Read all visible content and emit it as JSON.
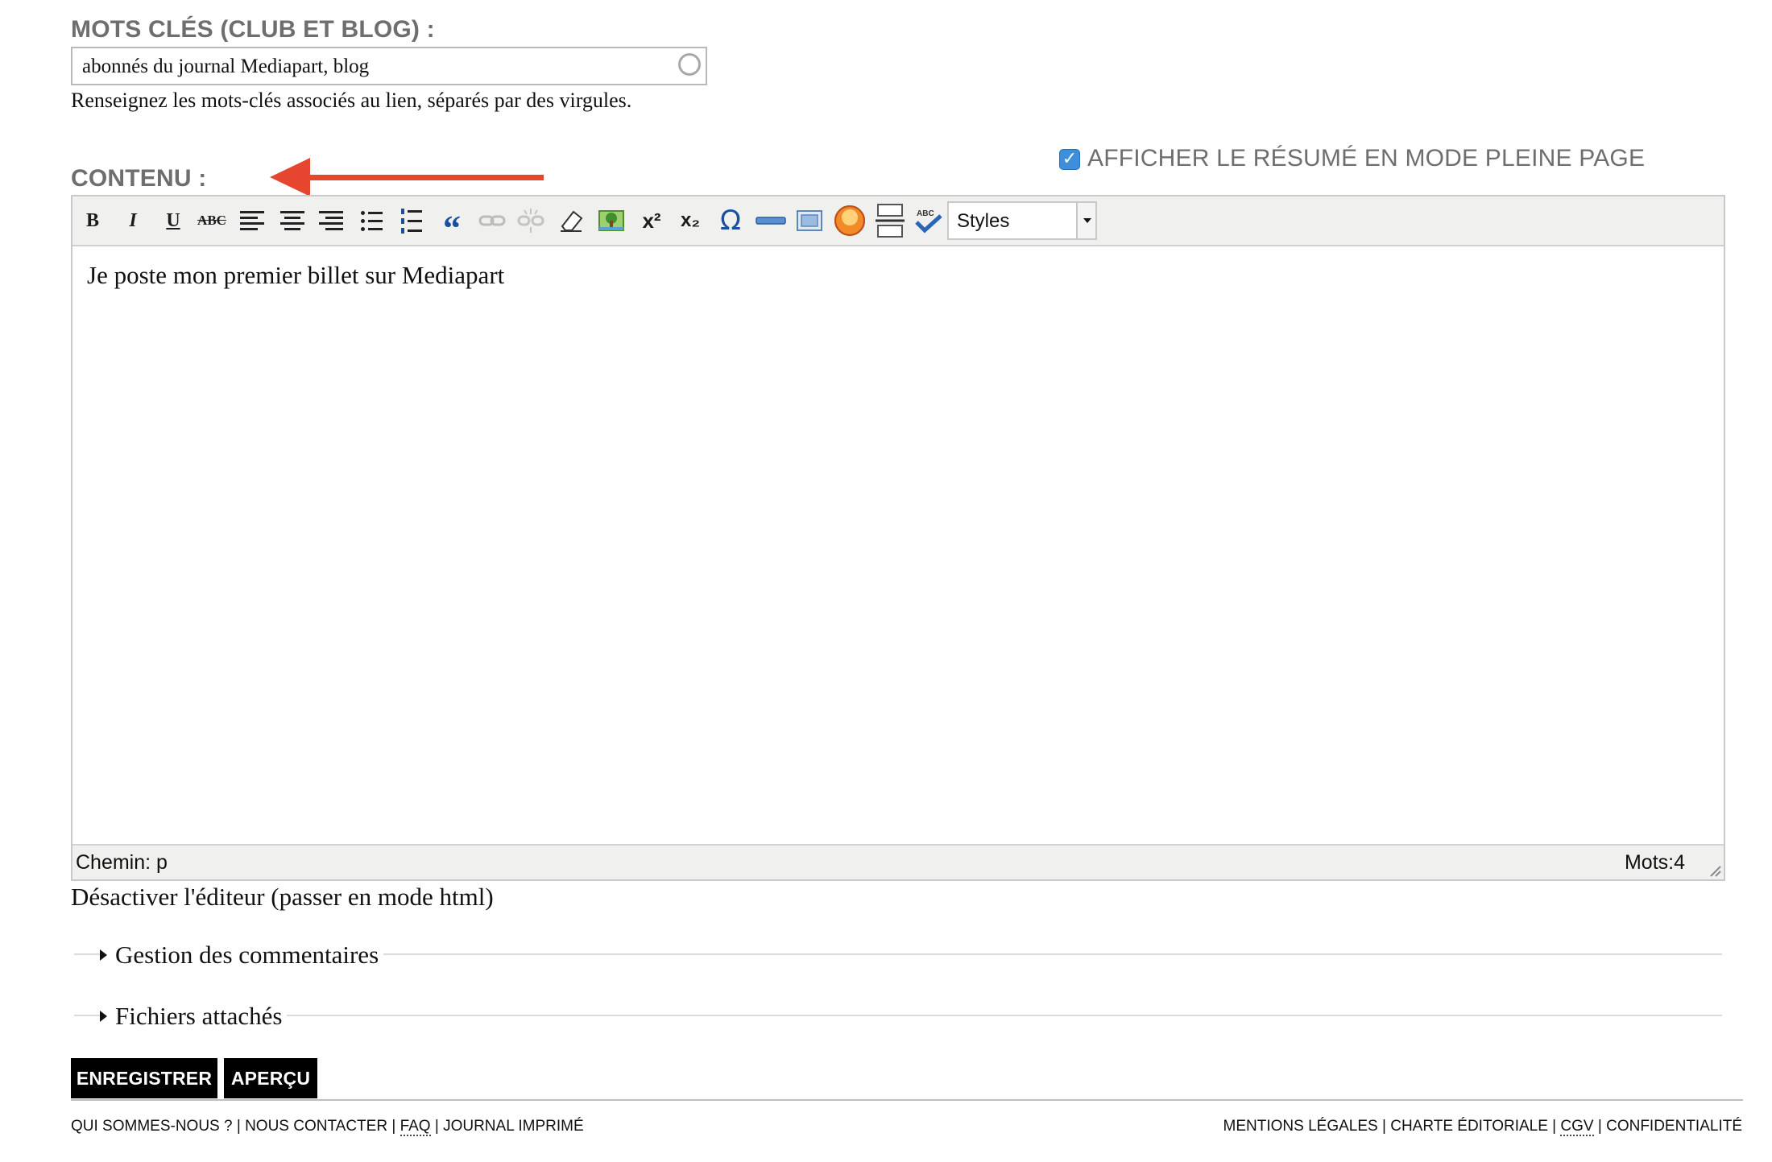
{
  "keywords": {
    "label": "MOTS CLÉS (CLUB ET BLOG) :",
    "value": "abonnés du journal Mediapart, blog",
    "help": "Renseignez les mots-clés associés au lien, séparés par des virgules."
  },
  "summary_option": {
    "checked": true,
    "label": "AFFICHER LE RÉSUMÉ EN MODE PLEINE PAGE"
  },
  "content": {
    "label": "CONTENU :",
    "toolbar": {
      "bold": "B",
      "italic": "I",
      "underline": "U",
      "strikethrough": "ABC",
      "blockquote": "“",
      "superscript": "x²",
      "subscript": "x₂",
      "special_char": "Ω",
      "styles_value": "Styles"
    },
    "text": "Je poste mon premier billet sur Mediapart",
    "path": "Chemin: p",
    "word_count": "Mots:4"
  },
  "disable_editor": "Désactiver l'éditeur (passer en mode html)",
  "sections": [
    {
      "label": "Gestion des commentaires"
    },
    {
      "label": "Fichiers attachés"
    }
  ],
  "buttons": {
    "save": "ENREGISTRER",
    "preview": "APERÇU"
  },
  "footer": {
    "left": [
      "QUI SOMMES-NOUS ?",
      "NOUS CONTACTER",
      "FAQ",
      "JOURNAL IMPRIMÉ"
    ],
    "right": [
      "MENTIONS LÉGALES",
      "CHARTE ÉDITORIALE",
      "CGV",
      "CONFIDENTIALITÉ"
    ],
    "separator": " | "
  },
  "colors": {
    "arrow": "#e6462f",
    "checkbox": "#3d8fdb",
    "label_gray": "#6e6e6e"
  }
}
